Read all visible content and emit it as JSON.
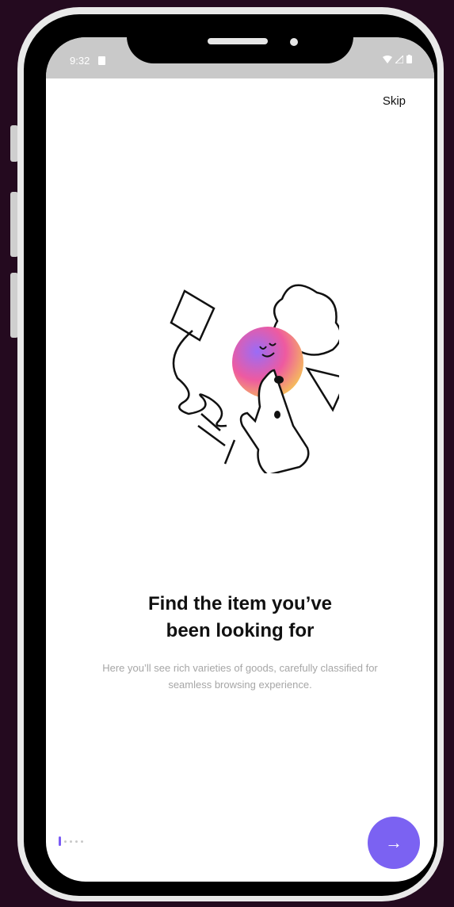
{
  "status_bar": {
    "time": "9:32",
    "sim_icon": "sim-card-icon",
    "wifi_icon": "wifi-icon",
    "signal_icon": "signal-icon",
    "battery_icon": "battery-icon"
  },
  "header": {
    "skip_label": "Skip"
  },
  "illustration": {
    "name": "hand-tap-illustration",
    "gradient": [
      "#8b6cf6",
      "#f6d44f",
      "#f35a8c"
    ]
  },
  "content": {
    "title_line1": "Find the item you’ve",
    "title_line2": "been looking for",
    "description_line1": "Here you’ll see rich varieties of goods, carefully classified for",
    "description_line2": "seamless browsing experience."
  },
  "pagination": {
    "current": 1,
    "total": 5
  },
  "footer": {
    "next_icon": "arrow-right-icon",
    "next_symbol": "→"
  },
  "colors": {
    "accent": "#7b62f2",
    "background": "#240a1f"
  }
}
